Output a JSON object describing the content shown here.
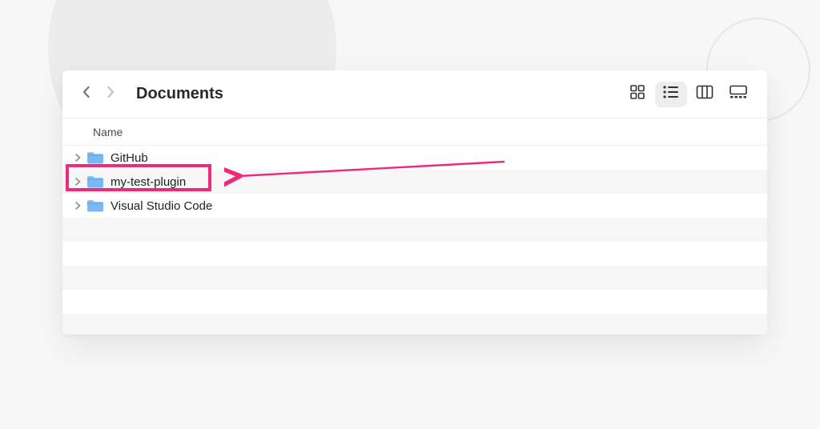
{
  "toolbar": {
    "title": "Documents",
    "back_icon": "chevron-left",
    "forward_icon": "chevron-right",
    "views": {
      "icon_view": "icon-view-icon",
      "list_view": "list-view-icon",
      "column_view": "column-view-icon",
      "gallery_view": "gallery-view-icon",
      "active_index": 1
    }
  },
  "columns": {
    "name": "Name"
  },
  "rows": [
    {
      "label": "GitHub",
      "type": "folder",
      "highlighted": false
    },
    {
      "label": "my-test-plugin",
      "type": "folder",
      "highlighted": true
    },
    {
      "label": "Visual Studio Code",
      "type": "folder",
      "highlighted": false
    }
  ],
  "annotation": {
    "highlight_color": "#ee2b7b"
  }
}
